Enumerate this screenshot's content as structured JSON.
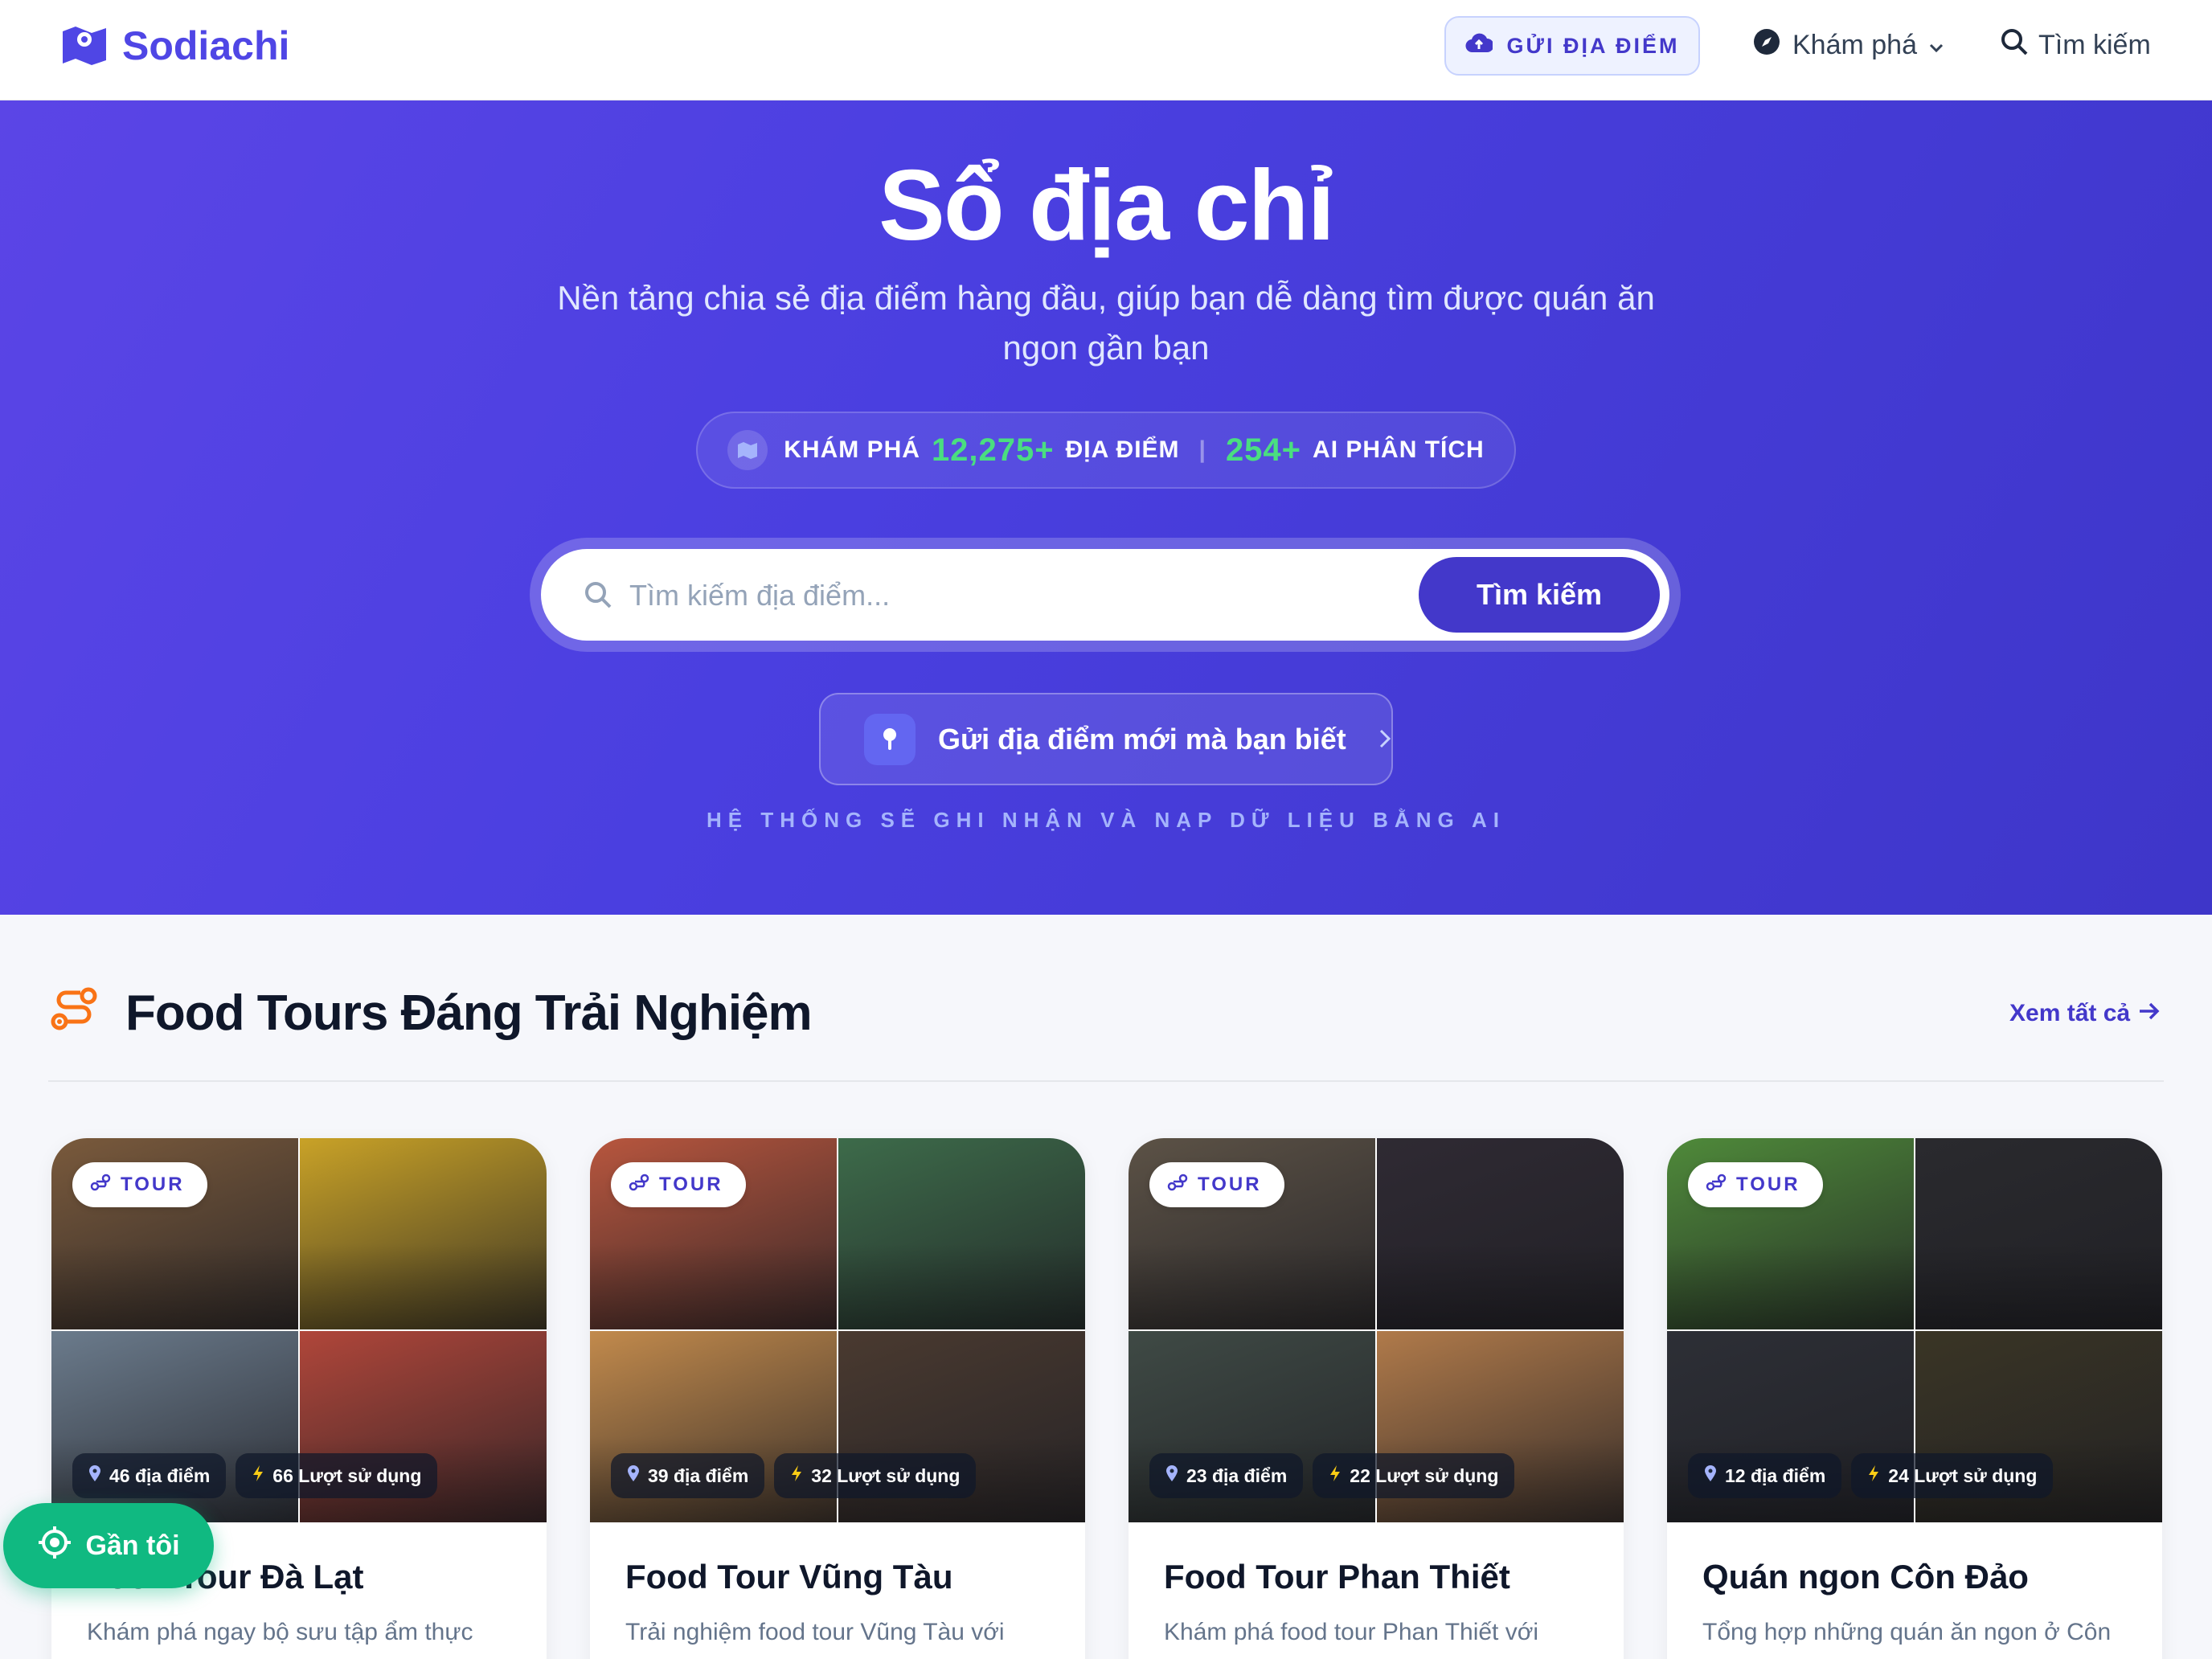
{
  "nav": {
    "logo": "Sodiachi",
    "submit_label": "GỬI ĐỊA ĐIỂM",
    "explore_label": "Khám phá",
    "search_label": "Tìm kiếm"
  },
  "hero": {
    "title": "Sổ địa chỉ",
    "subtitle": "Nền tảng chia sẻ địa điểm hàng đầu, giúp bạn dễ dàng tìm được quán ăn ngon gần bạn",
    "stats": {
      "explore_label": "KHÁM PHÁ",
      "places_count": "12,275+",
      "places_label": "ĐỊA ĐIỂM",
      "separator": "|",
      "ai_count": "254+",
      "ai_label": "AI PHÂN TÍCH"
    },
    "search": {
      "placeholder": "Tìm kiếm địa điểm...",
      "button": "Tìm kiếm"
    },
    "submit_new": "Gửi địa điểm mới mà bạn biết",
    "note": "HỆ THỐNG SẼ GHI NHẬN VÀ NẠP DỮ LIỆU BẰNG AI"
  },
  "section": {
    "title": "Food Tours Đáng Trải Nghiệm",
    "see_all": "Xem tất cả"
  },
  "cards": [
    {
      "tag": "TOUR",
      "places": "46 địa điểm",
      "uses": "66 Lượt sử dụng",
      "title": "Food Tour Đà Lạt",
      "desc": "Khám phá ngay bộ sưu tập ẩm thực",
      "tiles": [
        "#7a5a3c",
        "#c9a227",
        "#6b7b8c",
        "#b0463a"
      ]
    },
    {
      "tag": "TOUR",
      "places": "39 địa điểm",
      "uses": "32 Lượt sử dụng",
      "title": "Food Tour Vũng Tàu",
      "desc": "Trải nghiệm food tour Vũng Tàu với",
      "tiles": [
        "#b8563e",
        "#3d6b4a",
        "#c28a4c",
        "#4a3a30"
      ]
    },
    {
      "tag": "TOUR",
      "places": "23 địa điểm",
      "uses": "22 Lượt sử dụng",
      "title": "Food Tour Phan Thiết",
      "desc": "Khám phá food tour Phan Thiết với",
      "tiles": [
        "#5c5246",
        "#2f2a33",
        "#3f4a45",
        "#b07a4a"
      ]
    },
    {
      "tag": "TOUR",
      "places": "12 địa điểm",
      "uses": "24 Lượt sử dụng",
      "title": "Quán ngon Côn Đảo",
      "desc": "Tổng hợp những quán ăn ngon ở Côn",
      "tiles": [
        "#4f8a3a",
        "#2a2a2e",
        "#2d2f36",
        "#3a3525"
      ]
    }
  ],
  "near_me": "Gần tôi",
  "colors": {
    "brand": "#4f46e5",
    "hero_bg": "#4a3fe0",
    "accent_green": "#4ade80",
    "fab": "#10b981",
    "tour_icon": "#f97316"
  }
}
